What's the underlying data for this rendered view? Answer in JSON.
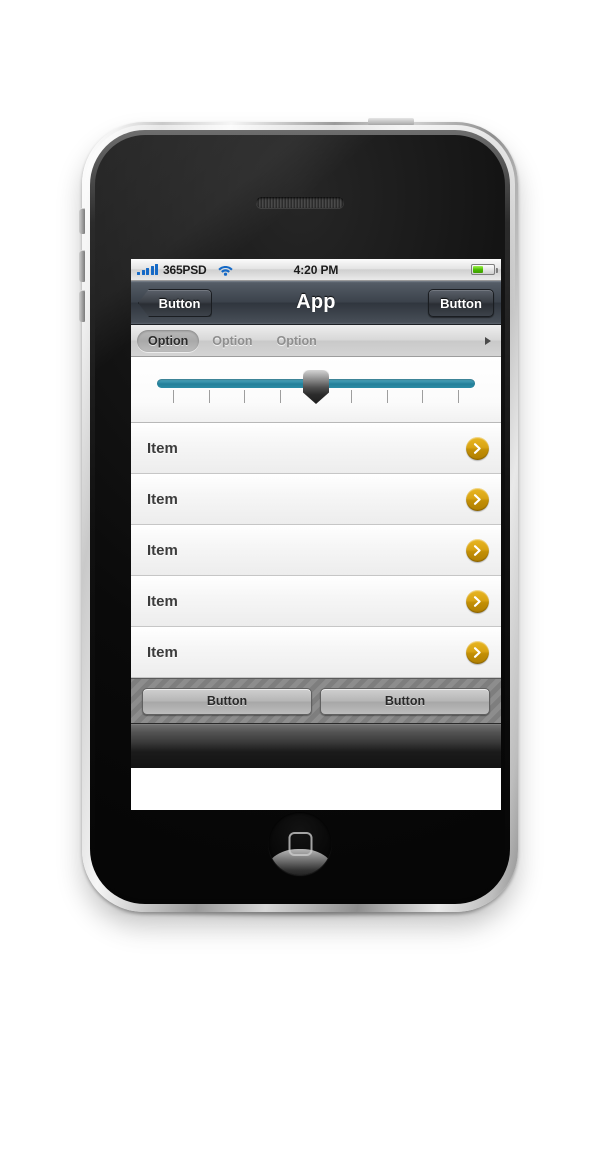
{
  "device": {
    "name": "iphone-3gs",
    "earpiece_label": "earpiece-speaker",
    "home_button_label": "home-button"
  },
  "status_bar": {
    "carrier": "365PSD",
    "signal_icon": "signal-bars-icon",
    "wifi_icon": "wifi-icon",
    "time": "4:20 PM",
    "battery_icon": "battery-icon",
    "battery_level_percent": 52
  },
  "nav_bar": {
    "back_button_label": "Button",
    "title": "App",
    "right_button_label": "Button"
  },
  "option_bar": {
    "items": [
      {
        "label": "Option",
        "selected": true
      },
      {
        "label": "Option",
        "selected": false
      },
      {
        "label": "Option",
        "selected": false
      }
    ],
    "more_arrow_icon": "chevron-right-icon"
  },
  "slider": {
    "name": "value-slider",
    "value_percent": 50,
    "tick_count": 9,
    "track_color": "#2e8aa4",
    "thumb_color": "#2c2c2c"
  },
  "list": {
    "rows": [
      {
        "label": "Item",
        "disclosure_icon": "chevron-right-icon"
      },
      {
        "label": "Item",
        "disclosure_icon": "chevron-right-icon"
      },
      {
        "label": "Item",
        "disclosure_icon": "chevron-right-icon"
      },
      {
        "label": "Item",
        "disclosure_icon": "chevron-right-icon"
      },
      {
        "label": "Item",
        "disclosure_icon": "chevron-right-icon"
      }
    ],
    "disclosure_color": "#d9a414"
  },
  "toolbar": {
    "buttons": [
      {
        "label": "Button"
      },
      {
        "label": "Button"
      }
    ]
  },
  "footer": {
    "name": "footer-bar"
  }
}
